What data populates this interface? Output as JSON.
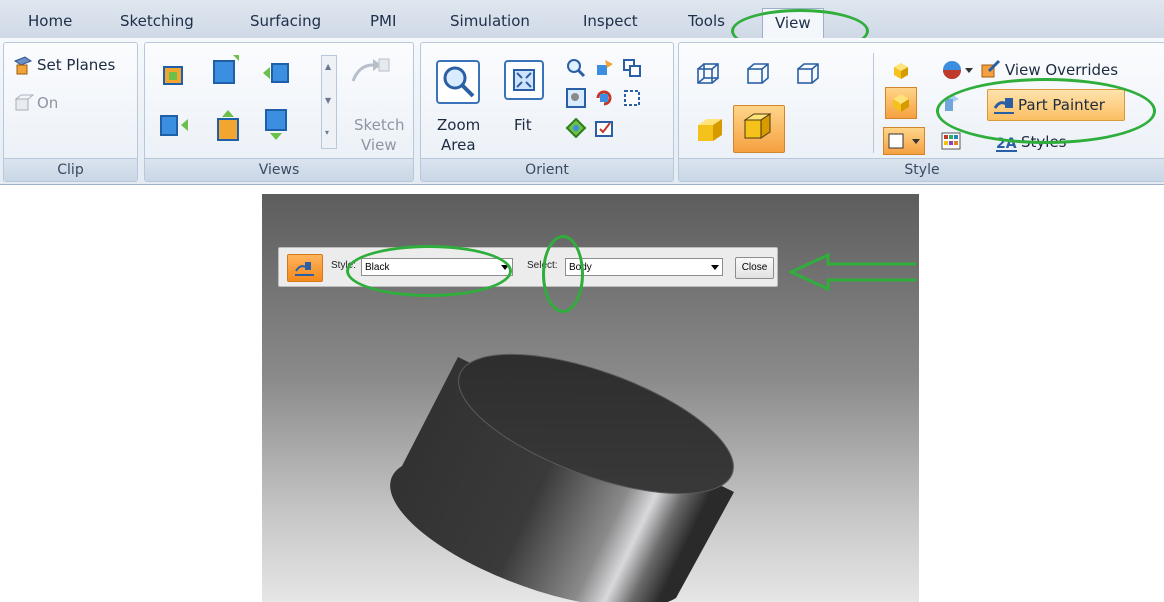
{
  "tabs": [
    "Home",
    "Sketching",
    "Surfacing",
    "PMI",
    "Simulation",
    "Inspect",
    "Tools",
    "View"
  ],
  "active_tab": "View",
  "ribbon": {
    "clip": {
      "set_planes": "Set Planes",
      "on": "On",
      "label": "Clip"
    },
    "views": {
      "sketch_view_line1": "Sketch",
      "sketch_view_line2": "View",
      "label": "Views"
    },
    "orient": {
      "zoom_area_line1": "Zoom",
      "zoom_area_line2": "Area",
      "fit": "Fit",
      "label": "Orient"
    },
    "style": {
      "view_overrides": "View Overrides",
      "part_painter": "Part Painter",
      "styles": "Styles",
      "label": "Style"
    }
  },
  "part_painter_bar": {
    "style_label": "Style:",
    "style_value": "Black",
    "select_label": "Select:",
    "select_value": "Body",
    "close": "Close"
  },
  "colors": {
    "annotation_green": "#2fae3c",
    "active_button_orange": "#f5a040",
    "ribbon_blue": "#dfe6ef"
  },
  "icons": [
    "set-planes-icon",
    "zoom-area-icon",
    "fit-icon",
    "part-painter-icon",
    "view-overrides-icon",
    "styles-icon"
  ]
}
